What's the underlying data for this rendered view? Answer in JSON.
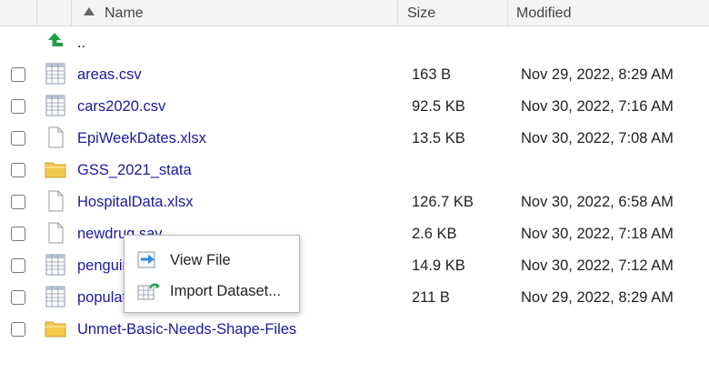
{
  "header": {
    "name": "Name",
    "size": "Size",
    "modified": "Modified"
  },
  "parent_dir": "..",
  "files": [
    {
      "name": "areas.csv",
      "size": "163 B",
      "modified": "Nov 29, 2022, 8:29 AM",
      "icon": "spreadsheet-icon"
    },
    {
      "name": "cars2020.csv",
      "size": "92.5 KB",
      "modified": "Nov 30, 2022, 7:16 AM",
      "icon": "spreadsheet-icon"
    },
    {
      "name": "EpiWeekDates.xlsx",
      "size": "13.5 KB",
      "modified": "Nov 30, 2022, 7:08 AM",
      "icon": "file-icon"
    },
    {
      "name": "GSS_2021_stata",
      "size": "",
      "modified": "",
      "icon": "folder-icon"
    },
    {
      "name": "HospitalData.xlsx",
      "size": "126.7 KB",
      "modified": "Nov 30, 2022, 6:58 AM",
      "icon": "file-icon"
    },
    {
      "name": "newdrug.sav",
      "size": "2.6 KB",
      "modified": "Nov 30, 2022, 7:18 AM",
      "icon": "file-icon"
    },
    {
      "name": "penguins.csv",
      "size": "14.9 KB",
      "modified": "Nov 30, 2022, 7:12 AM",
      "icon": "spreadsheet-icon"
    },
    {
      "name": "population.csv",
      "size": "211 B",
      "modified": "Nov 29, 2022, 8:29 AM",
      "icon": "spreadsheet-icon"
    },
    {
      "name": "Unmet-Basic-Needs-Shape-Files",
      "size": "",
      "modified": "",
      "icon": "folder-icon"
    }
  ],
  "context_menu": {
    "items": [
      {
        "label": "View File",
        "icon": "view-file-icon"
      },
      {
        "label": "Import Dataset...",
        "icon": "import-dataset-icon"
      }
    ]
  },
  "colors": {
    "link": "#1a1a9c",
    "header_bg": "#f4f4f4",
    "folder": "#f2c94c",
    "up_arrow": "#1f9e49"
  }
}
